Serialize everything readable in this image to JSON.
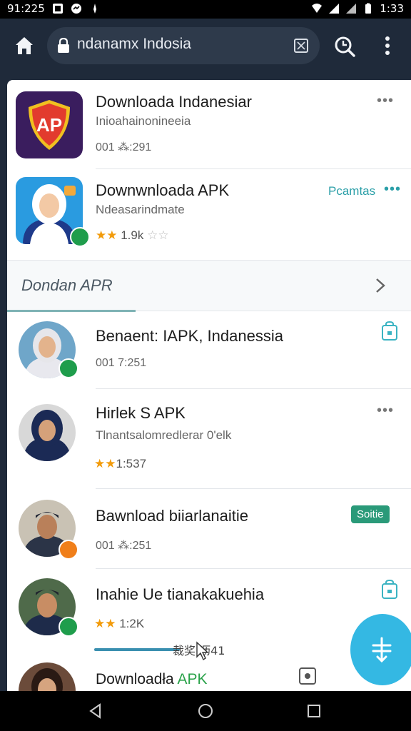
{
  "status_bar": {
    "time_left": "91:225",
    "time_right": "1:33"
  },
  "toolbar": {
    "url": "ndanamx Indosia"
  },
  "top_list": [
    {
      "title": "Downloada Indanesiar",
      "subtitle": "Inioahainonineeia",
      "meta": "001 ⁂:291",
      "action": "•••"
    },
    {
      "title": "Downwnloada APK",
      "subtitle": "Ndeasarindmate",
      "rating_text": "1.9k",
      "action_label": "Pcamtas",
      "action": "•••"
    }
  ],
  "section": {
    "title": "Dondan APR"
  },
  "list": [
    {
      "title": "Benaent: IAPK, Indanessia",
      "meta": "001 7:251",
      "badge_color": "#1f9d4c"
    },
    {
      "title": "Hirlek S APK",
      "subtitle": "Tlnantsalomredlerar 0'elk",
      "rating_text": "1:537",
      "action": "•••",
      "badge_color": "#1f9d4c"
    },
    {
      "title": "Bawnload biiarlanaitie",
      "meta": "001 ⁂:251",
      "pill": "Soitie",
      "badge_color": "#f07f1a"
    },
    {
      "title": "Inahie Ue tianakakuehia",
      "rating_text": "1:2K",
      "badge_color": "#1f9d4c"
    },
    {
      "title_a": "Downloadła",
      "title_b": "APK"
    }
  ],
  "overlay": {
    "progress_text": "裁奖 沥41"
  },
  "colors": {
    "accent": "#34b8e3",
    "teal": "#2a9a79",
    "star": "#f29b0b",
    "toolbar": "#1f2a3a"
  }
}
